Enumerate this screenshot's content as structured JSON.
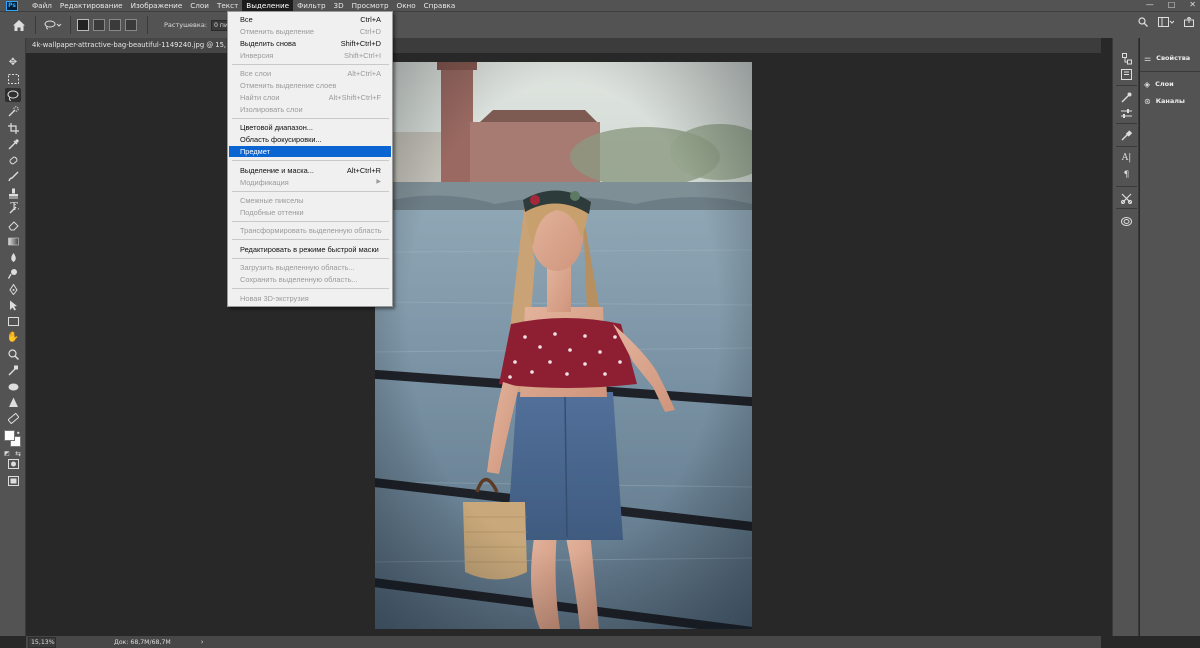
{
  "app": {
    "logo": "Ps"
  },
  "menubar": {
    "items": [
      "Файл",
      "Редактирование",
      "Изображение",
      "Слои",
      "Текст",
      "Выделение",
      "Фильтр",
      "3D",
      "Просмотр",
      "Окно",
      "Справка"
    ],
    "active_index": 5,
    "window_controls": [
      "—",
      "□",
      "✕"
    ]
  },
  "options_bar": {
    "feather_label": "Растушевка:",
    "feather_value": "0 пикс."
  },
  "document": {
    "tab_title": "4k-wallpaper-attractive-bag-beautiful-1149240.jpg @ 15,1%"
  },
  "status_bar": {
    "zoom": "15,13%",
    "doc_info": "Док: 68,7M/68,7M",
    "arrow": "›"
  },
  "panels": {
    "properties": "Свойства",
    "layers": "Слои",
    "channels": "Каналы"
  },
  "select_menu": {
    "items": [
      {
        "label": "Все",
        "shortcut": "Ctrl+A",
        "disabled": false
      },
      {
        "label": "Отменить выделение",
        "shortcut": "Ctrl+D",
        "disabled": true
      },
      {
        "label": "Выделить снова",
        "shortcut": "Shift+Ctrl+D",
        "disabled": false
      },
      {
        "label": "Инверсия",
        "shortcut": "Shift+Ctrl+I",
        "disabled": true
      },
      {
        "label": "Все слои",
        "shortcut": "Alt+Ctrl+A",
        "disabled": true
      },
      {
        "label": "Отменить выделение слоев",
        "shortcut": "",
        "disabled": true
      },
      {
        "label": "Найти слои",
        "shortcut": "Alt+Shift+Ctrl+F",
        "disabled": true
      },
      {
        "label": "Изолировать слои",
        "shortcut": "",
        "disabled": true
      },
      {
        "label": "Цветовой диапазон...",
        "shortcut": "",
        "disabled": false
      },
      {
        "label": "Область фокусировки...",
        "shortcut": "",
        "disabled": false
      },
      {
        "label": "Предмет",
        "shortcut": "",
        "disabled": false,
        "highlighted": true
      },
      {
        "label": "Выделение и маска...",
        "shortcut": "Alt+Ctrl+R",
        "disabled": false
      },
      {
        "label": "Модификация",
        "shortcut": "",
        "disabled": true,
        "submenu": true
      },
      {
        "label": "Смежные пикселы",
        "shortcut": "",
        "disabled": true
      },
      {
        "label": "Подобные оттенки",
        "shortcut": "",
        "disabled": true
      },
      {
        "label": "Трансформировать выделенную область",
        "shortcut": "",
        "disabled": true
      },
      {
        "label": "Редактировать в режиме быстрой маски",
        "shortcut": "",
        "disabled": false
      },
      {
        "label": "Загрузить выделенную область...",
        "shortcut": "",
        "disabled": true
      },
      {
        "label": "Сохранить выделенную область...",
        "shortcut": "",
        "disabled": true
      },
      {
        "label": "Новая 3D-экструзия",
        "shortcut": "",
        "disabled": true
      }
    ]
  },
  "colors": {
    "menu_highlight": "#0a64d2",
    "panel_bg": "#535353",
    "canvas_bg": "#282828"
  }
}
